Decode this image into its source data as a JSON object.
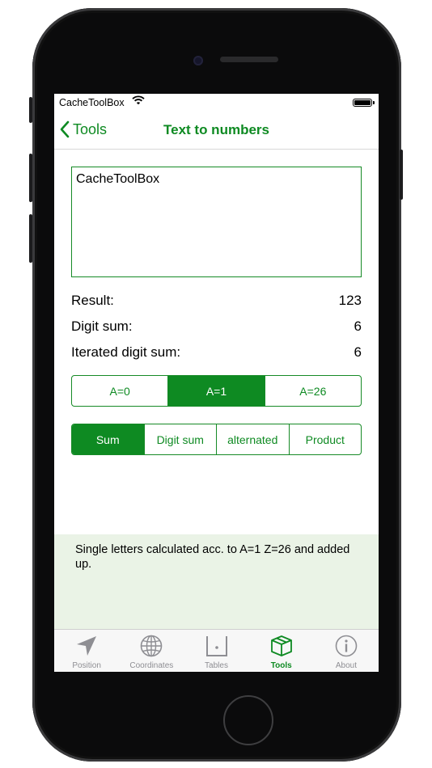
{
  "status": {
    "carrier": "CacheToolBox"
  },
  "nav": {
    "back_label": "Tools",
    "title": "Text to numbers"
  },
  "input": {
    "value": "CacheToolBox"
  },
  "results": [
    {
      "label": "Result:",
      "value": "123"
    },
    {
      "label": "Digit sum:",
      "value": "6"
    },
    {
      "label": "Iterated digit sum:",
      "value": "6"
    }
  ],
  "offset_segment": {
    "options": [
      "A=0",
      "A=1",
      "A=26"
    ],
    "selected": "A=1"
  },
  "mode_segment": {
    "options": [
      "Sum",
      "Digit sum",
      "alternated",
      "Product"
    ],
    "selected": "Sum"
  },
  "info": {
    "text": "Single letters calculated acc. to A=1 Z=26 and added up."
  },
  "tabbar": {
    "items": [
      {
        "label": "Position",
        "icon": "location-arrow-icon"
      },
      {
        "label": "Coordinates",
        "icon": "globe-icon"
      },
      {
        "label": "Tables",
        "icon": "table-icon"
      },
      {
        "label": "Tools",
        "icon": "box-icon"
      },
      {
        "label": "About",
        "icon": "info-icon"
      }
    ],
    "active": "Tools"
  },
  "colors": {
    "accent": "#0e8a22",
    "info_bg": "#eaf3e6"
  }
}
